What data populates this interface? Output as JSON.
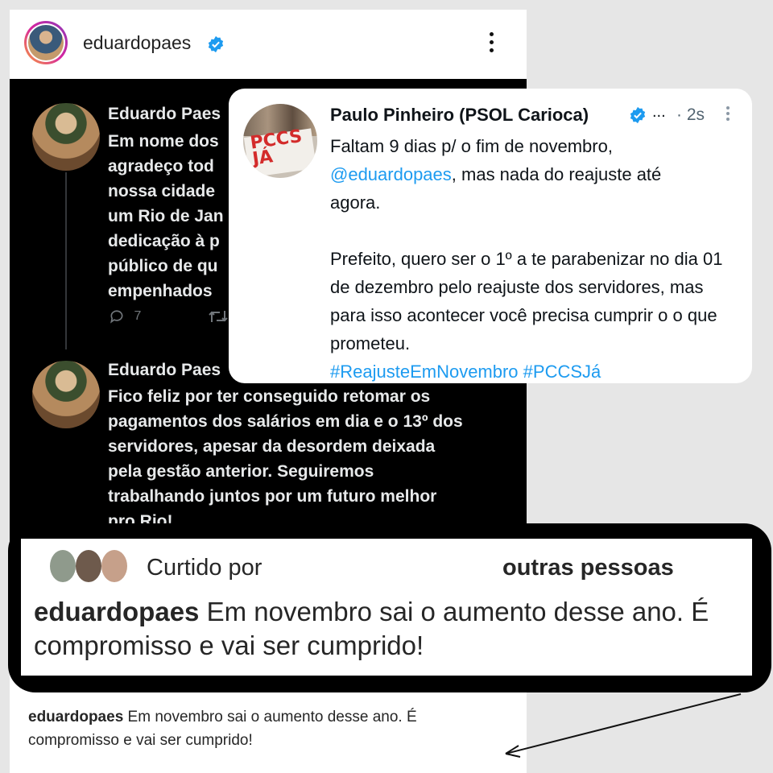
{
  "instagram": {
    "username": "eduardopaes",
    "avatar_icon": "profile-photo",
    "verified_icon": "verified-badge-icon",
    "more_icon": "more-vertical-icon"
  },
  "dark_tweets": [
    {
      "name": "Eduardo Paes",
      "text": "Em nome dos\nagradeço tod\nnossa cidade\num Rio de Jan\ndedicação à p\npúblico de qu\nempenhados",
      "replies": "7",
      "reply_icon": "reply-icon",
      "retweet_icon": "retweet-icon"
    },
    {
      "name": "Eduardo Paes",
      "text": "Fico feliz por ter conseguido retomar os\npagamentos dos salários em dia e o 13º dos\nservidores, apesar da desordem deixada\npela gestão anterior. Seguiremos\ntrabalhando juntos por um futuro melhor\npro Rio!"
    }
  ],
  "tweet_card": {
    "name": "Paulo Pinheiro (PSOL Carioca)",
    "ellipsis": "...",
    "time": "· 2s",
    "avatar_sign": "PCCS JÁ",
    "line1": "Faltam 9 dias p/ o fim de novembro,",
    "mention": "@eduardopaes",
    "line2_rest": ", mas nada do reajuste até",
    "line3": "agora.",
    "paragraph2": "Prefeito, quero ser o 1º a te parabenizar no dia 01 de dezembro pelo reajuste dos servidores, mas para isso acontecer você precisa cumprir o o que prometeu.",
    "hashtags": "#ReajusteEmNovembro #PCCSJá"
  },
  "zoom_comment": {
    "liked_by": "Curtido por",
    "liked_others": "outras pessoas",
    "username": "eduardopaes",
    "text": " Em novembro sai o aumento desse ano.  É compromisso e vai ser cumprido!"
  },
  "original_comment": {
    "username": "eduardopaes",
    "text": " Em novembro sai o aumento desse ano.  É compromisso e vai ser cumprido!"
  },
  "colors": {
    "twitter_blue": "#1d9bf0",
    "instagram_text": "#262626",
    "dark_bg": "#000000"
  }
}
